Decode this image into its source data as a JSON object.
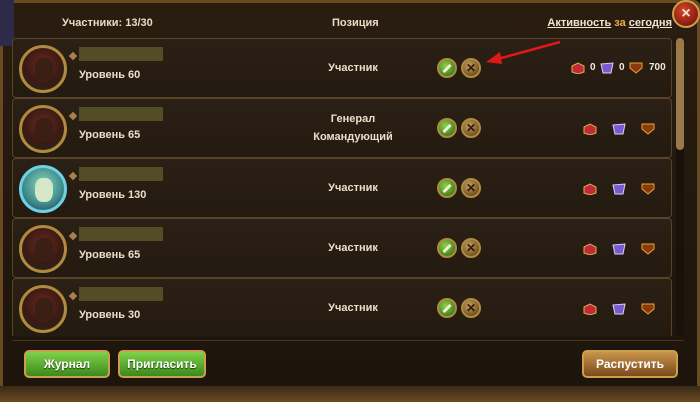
{
  "header": {
    "participants": "Участники: 13/30",
    "position": "Позиция",
    "activity_link": "Активность",
    "activity_mid": "за",
    "period_link": "сегодня"
  },
  "close_icon": "×",
  "members": [
    {
      "level": "Уровень 60",
      "role_line1": "Участник",
      "role_line2": "",
      "avatar": "red-warrior",
      "stat1": "0",
      "stat2": "0",
      "stat3": "700"
    },
    {
      "level": "Уровень 65",
      "role_line1": "Генерал",
      "role_line2": "Командующий",
      "avatar": "red-warrior",
      "stat1": "",
      "stat2": "",
      "stat3": ""
    },
    {
      "level": "Уровень 130",
      "role_line1": "Участник",
      "role_line2": "",
      "avatar": "blue-spirit",
      "stat1": "",
      "stat2": "",
      "stat3": ""
    },
    {
      "level": "Уровень 65",
      "role_line1": "Участник",
      "role_line2": "",
      "avatar": "red-warrior",
      "stat1": "",
      "stat2": "",
      "stat3": ""
    },
    {
      "level": "Уровень 30",
      "role_line1": "Участник",
      "role_line2": "",
      "avatar": "red-warrior",
      "stat1": "",
      "stat2": "",
      "stat3": ""
    }
  ],
  "row_buttons": {
    "edit_icon": "pencil-icon",
    "remove_icon": "x-icon",
    "remove_glyph": "✕"
  },
  "footer": {
    "journal": "Журнал",
    "invite": "Пригласить",
    "disband": "Распустить"
  },
  "colors": {
    "accent_gold": "#caa14a",
    "green_button": "#5bb030",
    "arrow_red": "#e01818"
  }
}
